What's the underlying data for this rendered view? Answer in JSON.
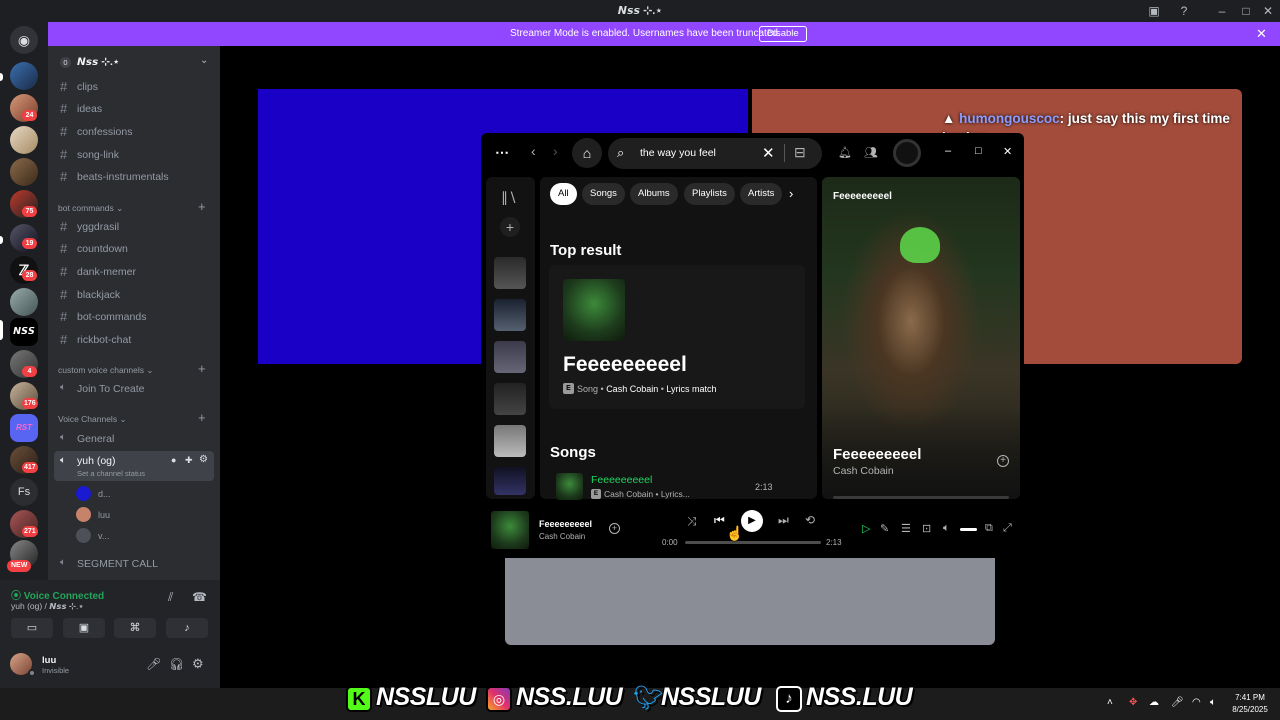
{
  "window": {
    "title": "𝙉𝙨𝙨 ⊹.⋆"
  },
  "banner": {
    "text": "Streamer Mode is enabled. Usernames have been truncated.",
    "button": "Disable"
  },
  "server": {
    "name": "𝙉𝙨𝙨 ⊹.⋆",
    "icon_text": "0"
  },
  "rail_badges": [
    "24",
    "75",
    "19",
    "28",
    "417",
    "271",
    "176",
    "4",
    "NEW"
  ],
  "rail_labels": {
    "fs": "Fs",
    "nss": "𝙉𝙎𝙎"
  },
  "channels_top": [
    "clips",
    "ideas",
    "confessions",
    "song-link",
    "beats-instrumentals"
  ],
  "bot_category": "bot commands",
  "bot_channels": [
    "yggdrasil",
    "countdown",
    "dank-memer",
    "blackjack",
    "bot-commands",
    "rickbot-chat"
  ],
  "custom_category": "custom voice channels",
  "custom_channels": [
    "Join To Create"
  ],
  "voice_category": "Voice Channels",
  "voice_channels": {
    "general": "General",
    "active": "yuh (og)",
    "status": "Set a channel status",
    "users": [
      "d...",
      "luu",
      "v..."
    ],
    "segment": "SEGMENT CALL"
  },
  "voice_panel": {
    "status": "Voice Connected",
    "location": "yuh (og) / 𝙉𝙨𝙨 ⊹.⋆"
  },
  "user": {
    "name": "luu",
    "status": "Invisible"
  },
  "chat_overlay": {
    "username": "humongouscoc",
    "message": "just say this my first time boxing"
  },
  "spotify": {
    "search_value": "the way you feel",
    "filters": [
      "All",
      "Songs",
      "Albums",
      "Playlists",
      "Artists"
    ],
    "top_result_heading": "Top result",
    "top_result_title": "Feeeeeeeeel",
    "top_result_badge": "E",
    "top_result_type": "Song",
    "top_result_artist": "Cash Cobain",
    "top_result_match": "Lyrics match",
    "songs_heading": "Songs",
    "song_title": "Feeeeeeeeel",
    "song_sub": "Cash Cobain • Lyrics...",
    "song_duration": "2:13",
    "nowplaying_panel_title": "Feeeeeeeeel",
    "nowplaying_big_title": "Feeeeeeeeel",
    "nowplaying_big_artist": "Cash Cobain",
    "player_title": "Feeeeeeeeel",
    "player_artist": "Cash Cobain",
    "time_elapsed": "0:00",
    "time_total": "2:13",
    "progress": 0.0
  },
  "socials": [
    "NSSLUU",
    "NSS.LUU",
    "NSSLUU",
    "NSS.LUU"
  ],
  "clock": {
    "time": "7:41 PM",
    "date": "8/25/2025"
  },
  "colors": {
    "accent": "#1ed760",
    "banner": "#9147ff",
    "brand_blue": "#1a00c7",
    "brand_rust": "#a34c3b"
  }
}
